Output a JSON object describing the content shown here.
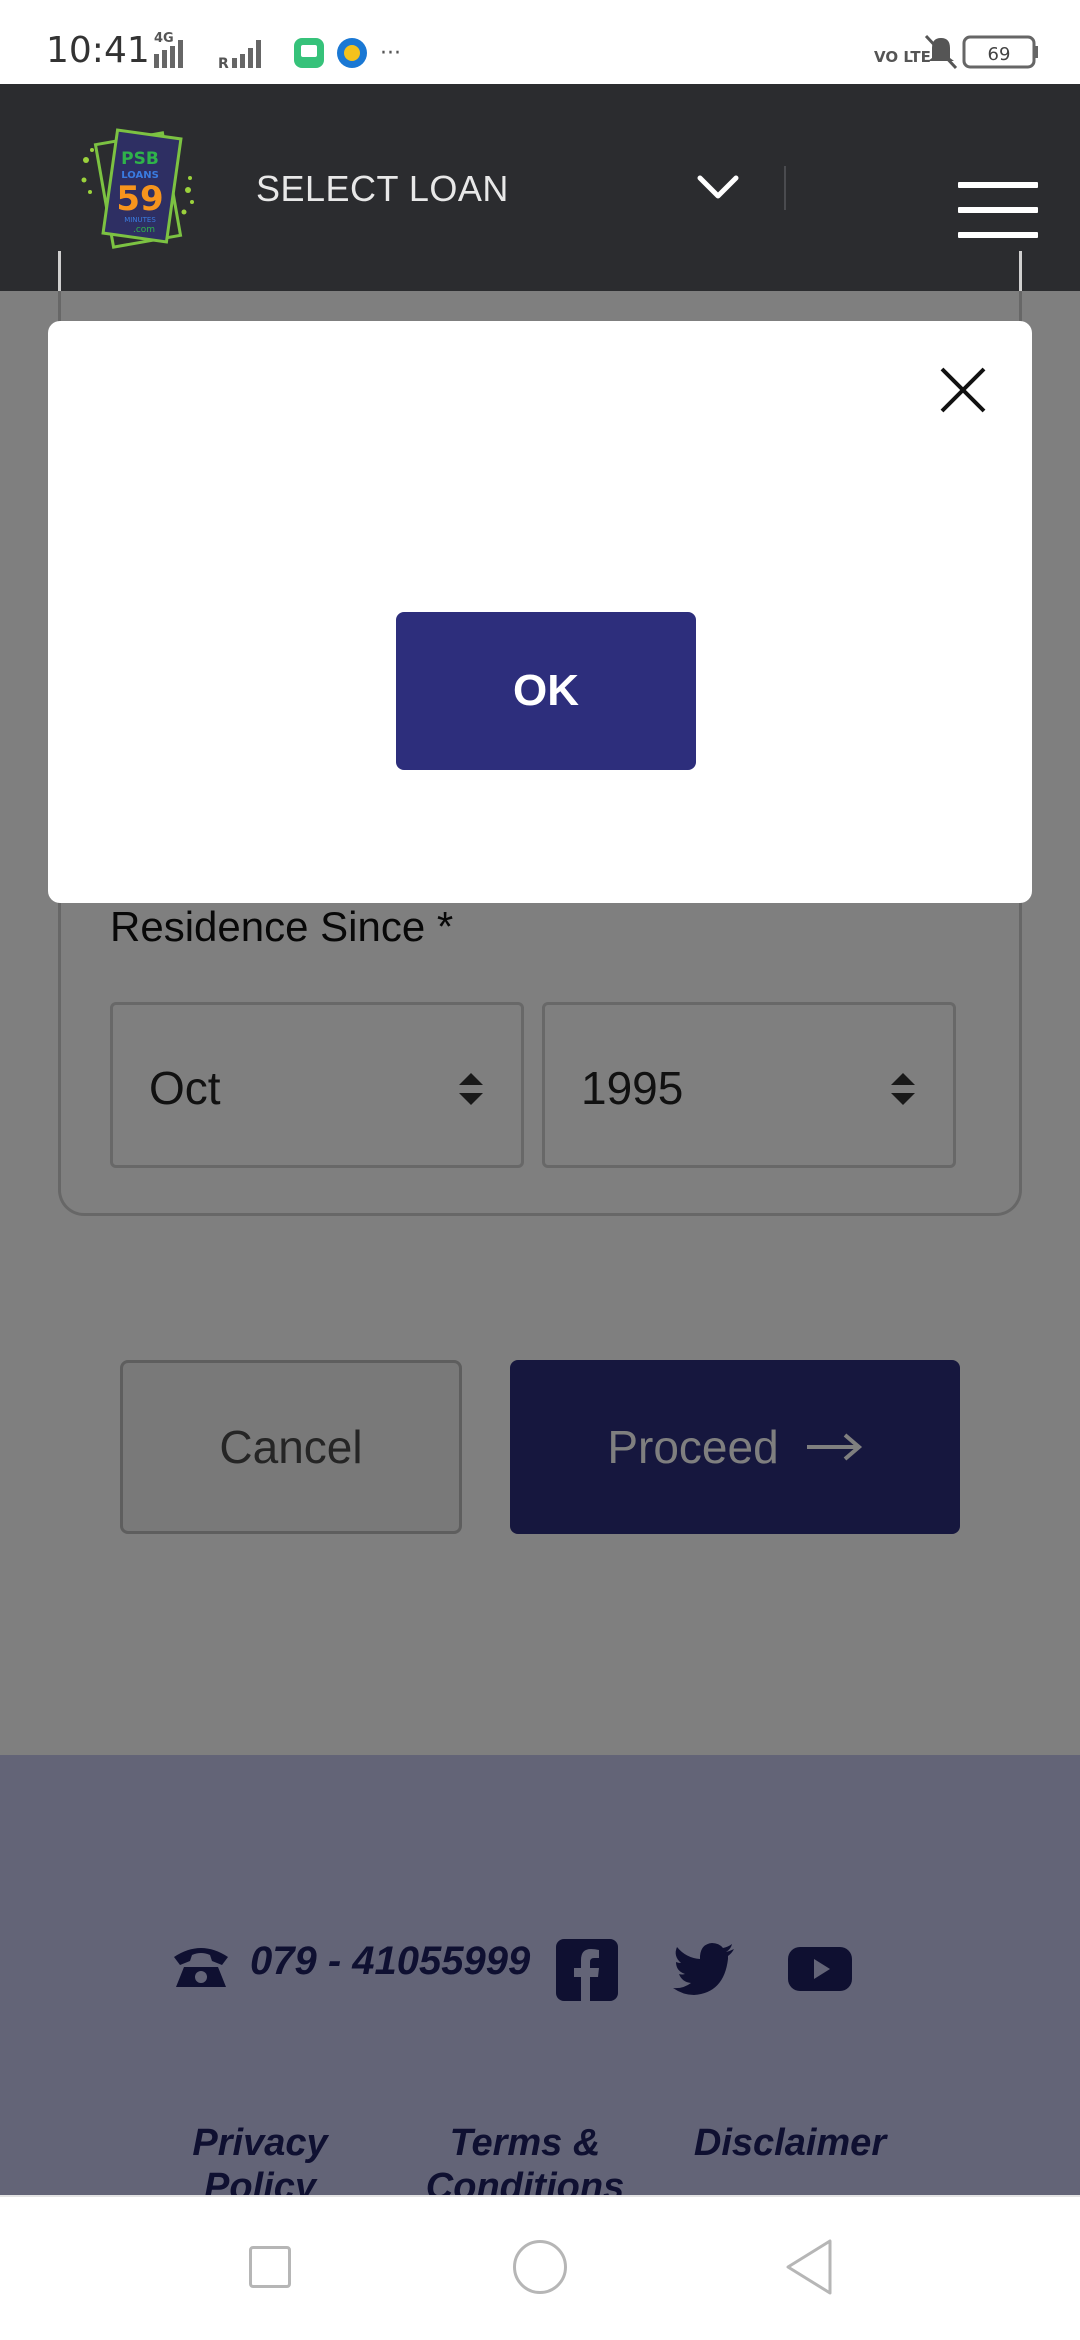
{
  "status_bar": {
    "time": "10:41",
    "network_label": "4G",
    "roaming_label": "R",
    "more_label": "···",
    "volte_label": "VO LTE",
    "battery": "69"
  },
  "header": {
    "logo_text_top": "PSB",
    "logo_text_mid": "LOANS",
    "logo_text_num": "59",
    "logo_text_sub": "MINUTES",
    "logo_text_dom": ".com",
    "select_label": "SELECT LOAN"
  },
  "form": {
    "residence_label": "Residence Since *",
    "month_value": "Oct",
    "year_value": "1995",
    "cancel_label": "Cancel",
    "proceed_label": "Proceed"
  },
  "footer": {
    "phone": "079 - 41055999",
    "links": [
      "Privacy Policy",
      "Terms & Conditions",
      "Disclaimer"
    ]
  },
  "modal": {
    "ok_label": "OK"
  },
  "colors": {
    "header_bg": "#2b2c2f",
    "primary": "#2d2e7c",
    "footer_bg": "#c6c9ee",
    "footer_text": "#1f2063"
  }
}
